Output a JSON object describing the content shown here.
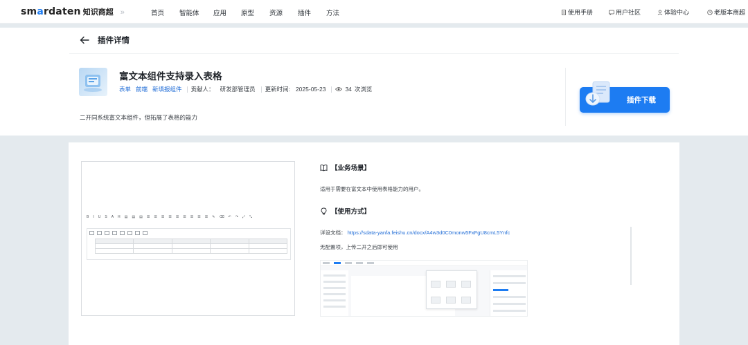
{
  "nav": {
    "logo_prefix": "sm",
    "logo_accent": "a",
    "logo_suffix": "rdaten",
    "logo_sub": "知识商超",
    "chevron": "»",
    "items": [
      "首页",
      "智能体",
      "应用",
      "原型",
      "资源",
      "插件",
      "方法"
    ],
    "right_items": [
      "使用手册",
      "用户社区",
      "体验中心",
      "老版本商超"
    ]
  },
  "page": {
    "back_title": "插件详情",
    "plugin_title": "富文本组件支持录入表格",
    "tags": [
      "表单",
      "前端",
      "新填报组件"
    ],
    "contributor_label": "贡献人：",
    "contributor": "研发部管理员",
    "updated_label": "更新时间:",
    "updated": "2025-05-23",
    "views": "34",
    "views_label": "次浏览",
    "description": "二开同系统富文本组件，但拓展了表格的能力",
    "download_label": "插件下载"
  },
  "content": {
    "scenario_heading": "【业务场景】",
    "scenario_text": "适用于需要在富文本中使用表格能力的用户。",
    "usage_heading": "【使用方式】",
    "doc_label": "详设文档：",
    "doc_link": "https://sdata-yanfa.feishu.cn/docx/A4w3d0C0monw5FxFgU8cmL5Ynfc",
    "usage_text": "无配置项，上传二开之后即可使用"
  },
  "colors": {
    "accent": "#1d7cf2",
    "link": "#1e6bd6",
    "page_bg": "#e4eaee"
  }
}
